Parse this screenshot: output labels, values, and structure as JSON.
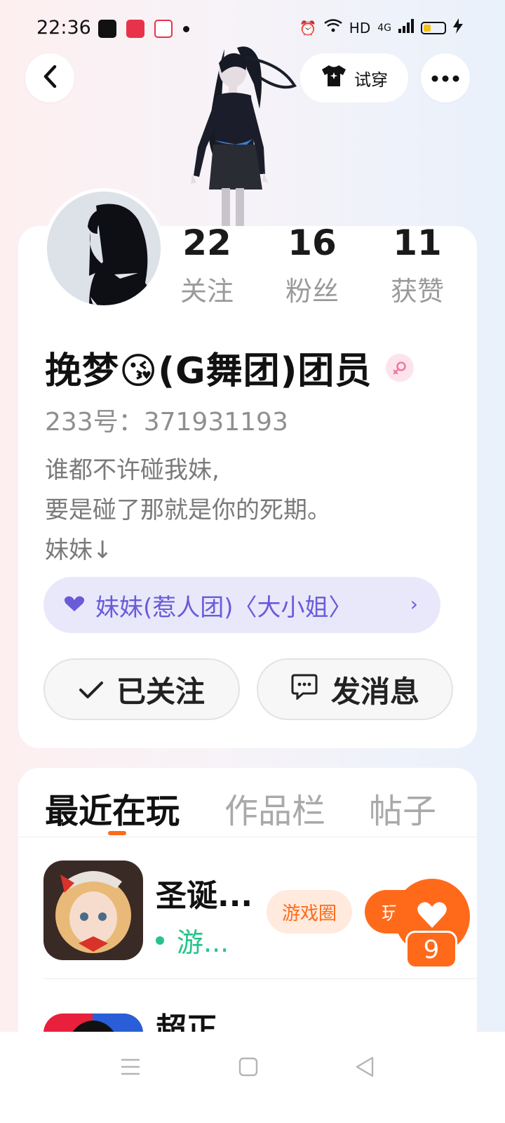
{
  "status_bar": {
    "time": "22:36",
    "network": "HD",
    "signal": "4G",
    "battery_level": 0.3
  },
  "header": {
    "back_icon": "chevron-left-icon",
    "tryon_label": "试穿",
    "more_icon": "more-horizontal-icon"
  },
  "profile": {
    "name": "挽梦😘(G舞团)团员",
    "gender_icon": "female-icon",
    "uid_label": "233号：371931193",
    "bio_line1": "谁都不许碰我妹,",
    "bio_line2": "要是碰了那就是你的死期。",
    "bio_line3": "妹妹↓",
    "group_link": "妹妹(惹人团)〈大小姐〉",
    "group_icon": "heart-icon"
  },
  "stats": [
    {
      "value": "22",
      "label": "关注"
    },
    {
      "value": "16",
      "label": "粉丝"
    },
    {
      "value": "11",
      "label": "获赞"
    }
  ],
  "actions": {
    "follow_label": "已关注",
    "message_label": "发消息"
  },
  "tabs": [
    {
      "label": "最近在玩",
      "active": true
    },
    {
      "label": "作品栏",
      "active": false
    },
    {
      "label": "帖子",
      "active": false
    }
  ],
  "recent_games": [
    {
      "title": "圣诞...",
      "status": "游...",
      "circle_label": "游戏圈",
      "play_label": "玩"
    },
    {
      "title": "超正..."
    }
  ],
  "like_fab": {
    "count": "9"
  },
  "colors": {
    "accent": "#ff6a1a",
    "group_chip": "#6a5bd8",
    "online": "#24c48a"
  }
}
